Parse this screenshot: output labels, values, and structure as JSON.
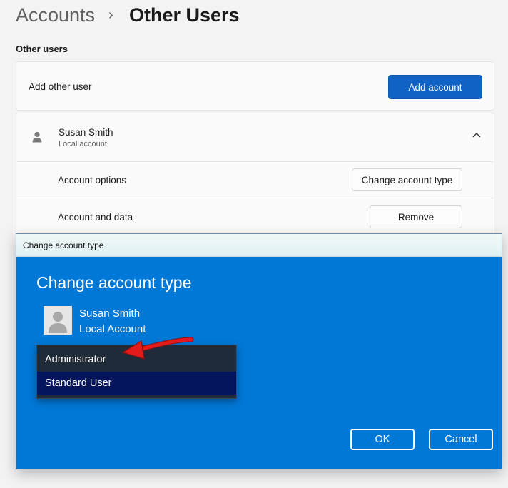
{
  "breadcrumb": {
    "parent": "Accounts",
    "separator": "›",
    "current": "Other Users"
  },
  "section_title": "Other users",
  "add_user": {
    "label": "Add other user",
    "button": "Add account"
  },
  "user": {
    "name": "Susan Smith",
    "type": "Local account",
    "rows": [
      {
        "label": "Account options",
        "button": "Change account type"
      },
      {
        "label": "Account and data",
        "button": "Remove"
      }
    ]
  },
  "dialog": {
    "window_title": "Change account type",
    "heading": "Change account type",
    "user_name": "Susan Smith",
    "user_type": "Local Account",
    "options": [
      "Administrator",
      "Standard User"
    ],
    "selected": "Standard User",
    "ok": "OK",
    "cancel": "Cancel"
  },
  "colors": {
    "accent": "#1063c4",
    "dialog_bg": "#0078d7",
    "dropdown_bg": "#1f2b38",
    "dropdown_selected": "#05155c",
    "annotation_arrow": "#e31b1b"
  },
  "icons": [
    "chevron-right-icon",
    "person-icon",
    "chevron-up-icon",
    "avatar-icon",
    "red-arrow-annotation"
  ]
}
